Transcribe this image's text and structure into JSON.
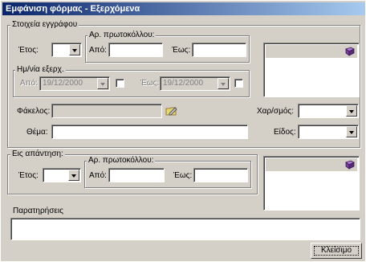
{
  "window": {
    "title": "Εμφάνιση φόρμας - Εξερχόμενα"
  },
  "document_group": {
    "legend": "Στοιχεία εγγράφου",
    "year_label": "Έτος:",
    "year_value": "",
    "protocol_group": {
      "legend": "Αρ. πρωτοκόλλου:",
      "from_label": "Από:",
      "from_value": "",
      "to_label": "Έως:",
      "to_value": ""
    },
    "date_group": {
      "legend": "Ημ/νία εξερχ.",
      "from_label": "Από:",
      "from_value": "19/12/2000",
      "to_label": "Έως:",
      "to_value": "19/12/2000"
    },
    "folder_label": "Φάκελος:",
    "folder_value": "",
    "subject_label": "Θέμα:",
    "subject_value": "",
    "charsign_label": "Χαρ/σμός:",
    "charsign_value": "",
    "type_label": "Είδος:",
    "type_value": ""
  },
  "reply_group": {
    "legend": "Εις απάντηση:",
    "year_label": "Έτος:",
    "year_value": "",
    "protocol_group": {
      "legend": "Αρ. πρωτοκόλλου:",
      "from_label": "Από:",
      "from_value": "",
      "to_label": "Έως:",
      "to_value": ""
    }
  },
  "remarks": {
    "label": "Παρατηρήσεις",
    "value": ""
  },
  "close_button": {
    "label": "Κλείσιμο"
  },
  "icons": {
    "book": "book-icon",
    "folder_pencil": "folder-edit-icon"
  },
  "colors": {
    "title_start": "#0a246a",
    "title_end": "#a6caf0",
    "face": "#d4d0c8",
    "book": "#7b3fa0"
  }
}
